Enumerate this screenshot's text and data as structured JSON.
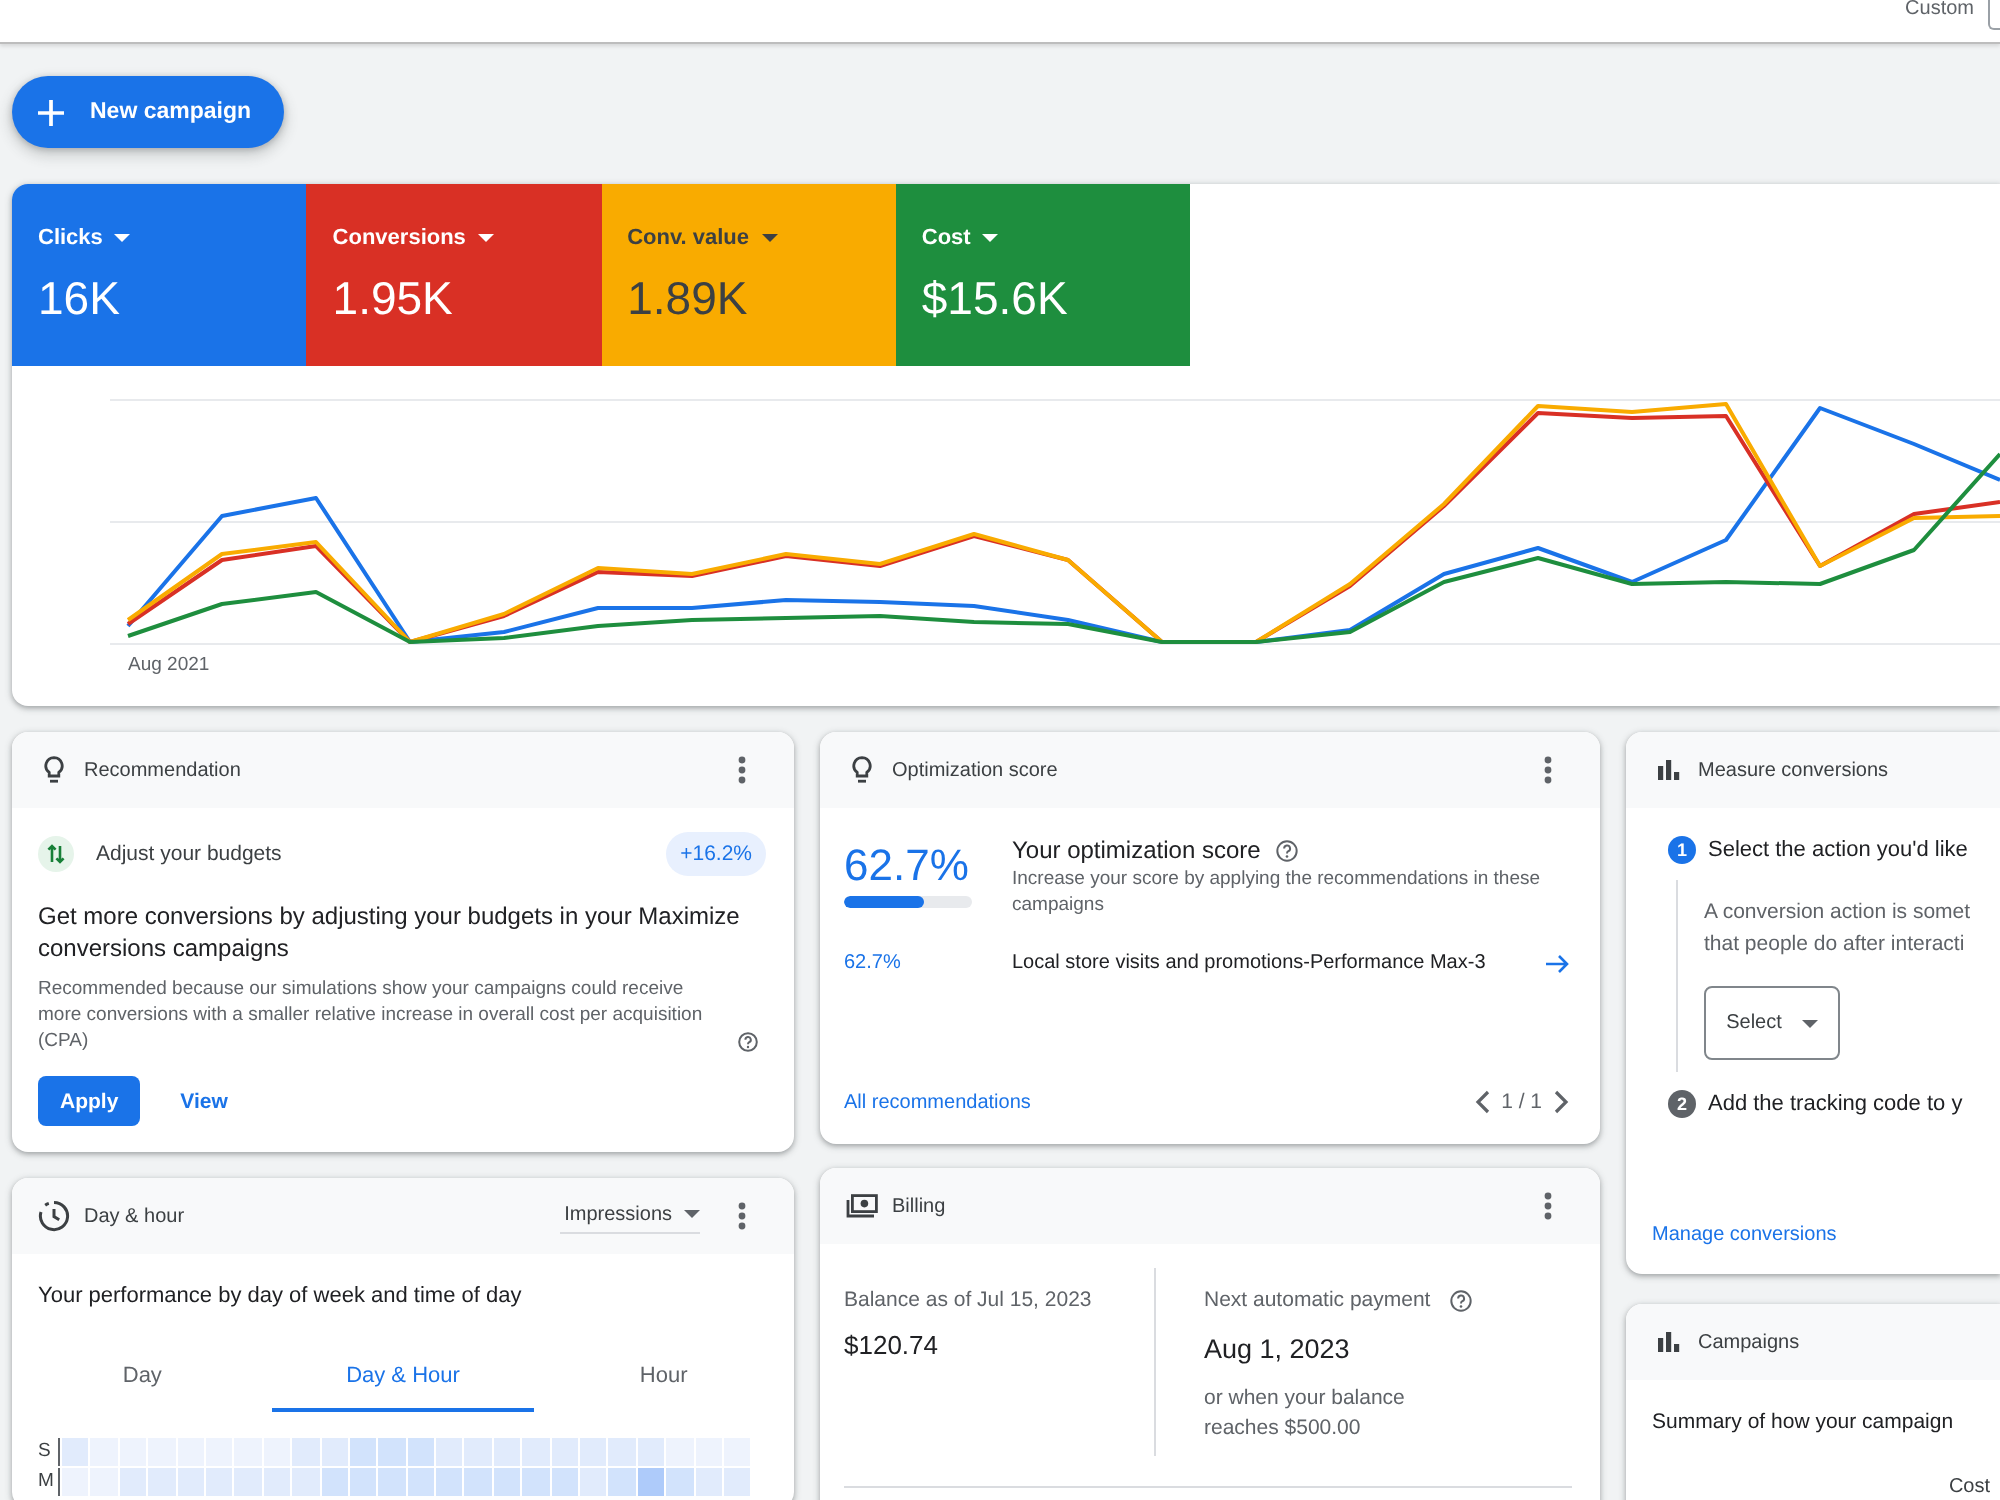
{
  "top_bar": {
    "date_range_label": "Custom"
  },
  "new_campaign_button": {
    "label": "New campaign"
  },
  "performance_chart": {
    "metrics": [
      {
        "label": "Clicks",
        "value": "16K",
        "color": "#1a73e8",
        "selected": true
      },
      {
        "label": "Conversions",
        "value": "1.95K",
        "color": "#d93025",
        "selected": true
      },
      {
        "label": "Conv. value",
        "value": "1.89K",
        "color": "#f9ab00",
        "selected": true
      },
      {
        "label": "Cost",
        "value": "$15.6K",
        "color": "#1e8e3e",
        "selected": true
      }
    ],
    "x_axis_label": "Aug 2021"
  },
  "recommendation_card": {
    "title": "Recommendation",
    "name": "Adjust your budgets",
    "uplift": "+16.2%",
    "heading": "Get more conversions by adjusting your budgets in your Maximize conversions campaigns",
    "description": "Recommended because our simulations show your campaigns could receive more conversions with a smaller relative increase in overall cost per acquisition (CPA)",
    "buttons": [
      {
        "label": "Apply",
        "kind": "primary"
      },
      {
        "label": "View",
        "kind": "link"
      }
    ]
  },
  "optimization_card": {
    "title": "Optimization score",
    "score": "62.7%",
    "level": 0.627,
    "heading": "Your optimization score",
    "description": "Increase your score by applying the recommendations in these campaigns",
    "campaigns": [
      {
        "score": "62.7%",
        "name": "Local store visits and promotions-Performance Max-3"
      }
    ],
    "link": "All recommendations",
    "pager": "1 / 1"
  },
  "measure_conversions_card": {
    "title": "Measure conversions",
    "steps": [
      {
        "number": "1",
        "label": "Select the action you'd like",
        "active": true,
        "description_lines": [
          "A conversion action is somet",
          "that people do after interacti"
        ],
        "select_label": "Select"
      },
      {
        "number": "2",
        "label": "Add the tracking code to y",
        "active": false
      }
    ],
    "link": "Manage conversions"
  },
  "day_hour_card": {
    "title": "Day & hour",
    "metric_dropdown": "Impressions",
    "subtitle": "Your performance by day of week and time of day",
    "tabs": [
      {
        "label": "Day",
        "selected": false
      },
      {
        "label": "Day & Hour",
        "selected": true
      },
      {
        "label": "Hour",
        "selected": false
      }
    ],
    "heatmap_rows": [
      "S",
      "M"
    ]
  },
  "billing_card": {
    "title": "Billing",
    "balance_label": "Balance as of Jul 15, 2023",
    "balance": "$120.74",
    "next_payment_label": "Next automatic payment",
    "next_payment_date": "Aug 1, 2023",
    "next_payment_note": "or when your balance reaches $500.00"
  },
  "campaigns_card": {
    "title": "Campaigns",
    "summary": "Summary of how your campaign",
    "columns": [
      "Cost"
    ]
  }
}
